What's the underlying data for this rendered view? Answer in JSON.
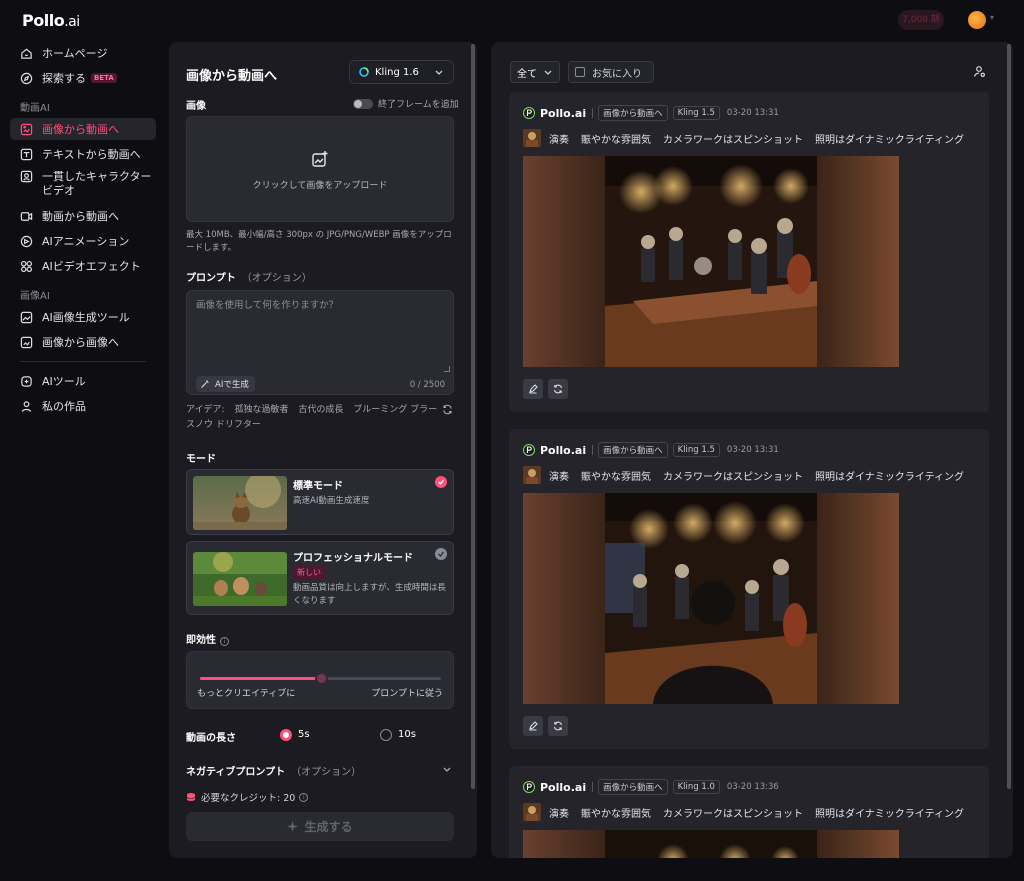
{
  "header": {
    "logo_main": "Pollo",
    "logo_suffix": ".ai",
    "top_pill": "7,000 期"
  },
  "sidebar": {
    "home": "ホームページ",
    "explore": "探索する",
    "explore_badge": "BETA",
    "section_video": "動画AI",
    "image_to_video": "画像から動画へ",
    "text_to_video": "テキストから動画へ",
    "consistent_character": "一貫したキャラクタービデオ",
    "video_to_video": "動画から動画へ",
    "ai_animation": "AIアニメーション",
    "ai_video_effects": "AIビデオエフェクト",
    "section_image": "画像AI",
    "ai_image_gen": "AI画像生成ツール",
    "image_to_image": "画像から画像へ",
    "ai_tools": "AIツール",
    "my_works": "私の作品"
  },
  "form": {
    "title": "画像から動画へ",
    "model": "Kling 1.6",
    "image_label": "画像",
    "end_frame_toggle": "終了フレームを追加",
    "upload_text": "クリックして画像をアップロード",
    "upload_hint": "最大 10MB、最小幅/高さ 300px の JPG/PNG/WEBP 画像をアップロードします。",
    "prompt_label": "プロンプト",
    "prompt_optional": "（オプション）",
    "prompt_placeholder": "画像を使用して何を作りますか？",
    "ai_generate": "AIで生成",
    "counter": "0 / 2500",
    "ideas_label": "アイデア:",
    "ideas": [
      "孤独な過敏者",
      "古代の成長",
      "ブルーミング ブラー",
      "スノウ ドリフター"
    ],
    "mode_label": "モード",
    "mode_standard_title": "標準モード",
    "mode_standard_sub": "高速AI動画生成速度",
    "mode_pro_title": "プロフェッショナルモード",
    "mode_pro_badge": "新しい",
    "mode_pro_sub": "動画品質は向上しますが、生成時間は長くなります",
    "immediacy_label": "即効性",
    "slider_value": 0.5,
    "slider_left": "もっとクリエイティブに",
    "slider_right": "プロンプトに従う",
    "duration_label": "動画の長さ",
    "duration_5": "5s",
    "duration_10": "10s",
    "negative_label": "ネガティブプロンプト",
    "negative_optional": "（オプション）",
    "credits": "必要なクレジット: 20",
    "generate": "生成する"
  },
  "feed": {
    "filter": "全て",
    "favorites": "お気に入り",
    "cards": [
      {
        "brand": "Pollo.ai",
        "tag": "画像から動画へ",
        "model": "Kling 1.5",
        "time": "03-20 13:31",
        "desc": [
          "演奏",
          "賑やかな雰囲気",
          "カメラワークはスピンショット",
          "照明はダイナミックライティング"
        ]
      },
      {
        "brand": "Pollo.ai",
        "tag": "画像から動画へ",
        "model": "Kling 1.5",
        "time": "03-20 13:31",
        "desc": [
          "演奏",
          "賑やかな雰囲気",
          "カメラワークはスピンショット",
          "照明はダイナミックライティング"
        ]
      },
      {
        "brand": "Pollo.ai",
        "tag": "画像から動画へ",
        "model": "Kling 1.0",
        "time": "03-20 13:36",
        "desc": [
          "演奏",
          "賑やかな雰囲気",
          "カメラワークはスピンショット",
          "照明はダイナミックライティング"
        ]
      }
    ]
  },
  "colors": {
    "accent": "#ff4f7a",
    "panel": "#1b1b21",
    "bg": "#0e0e12"
  }
}
